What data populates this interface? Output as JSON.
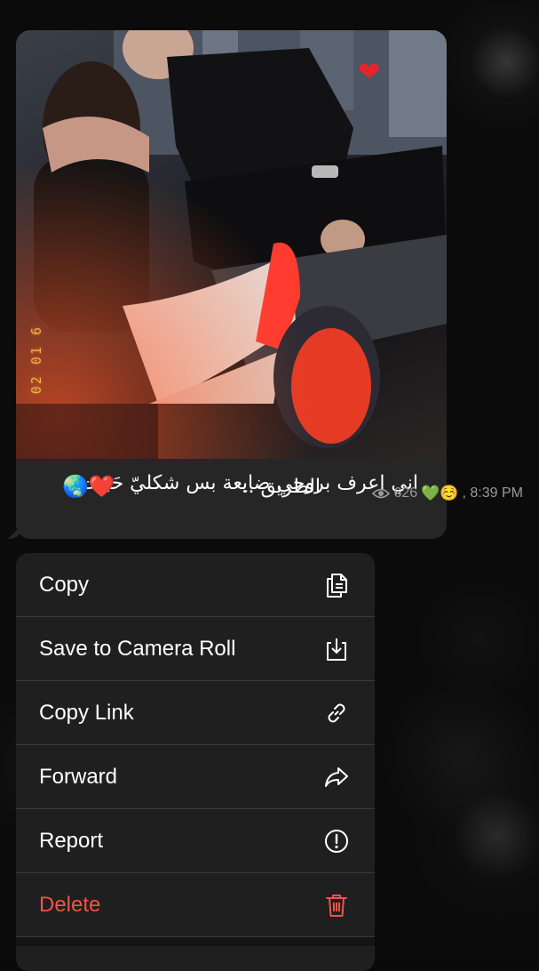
{
  "message": {
    "photo_date_stamp": "02 01 6",
    "caption_line1": "اني اعرف بروحي ضايعة بس شكليّ حَبيت",
    "caption_line2": "الطريق ..",
    "caption_emojis": "🌏❤️",
    "views": "626",
    "reactions": "💚☺️",
    "time": ", 8:39 PM"
  },
  "context_menu": {
    "items": [
      {
        "label": "Copy",
        "icon": "copy-icon"
      },
      {
        "label": "Save to Camera Roll",
        "icon": "save-download-icon"
      },
      {
        "label": "Copy Link",
        "icon": "link-icon"
      },
      {
        "label": "Forward",
        "icon": "forward-arrow-icon"
      },
      {
        "label": "Report",
        "icon": "report-exclamation-icon"
      },
      {
        "label": "Delete",
        "icon": "trash-icon"
      }
    ]
  },
  "colors": {
    "bubble_bg": "#262626",
    "menu_bg": "#1f1f1f",
    "danger": "#ec5449",
    "meta_text": "#9a9a9a"
  }
}
